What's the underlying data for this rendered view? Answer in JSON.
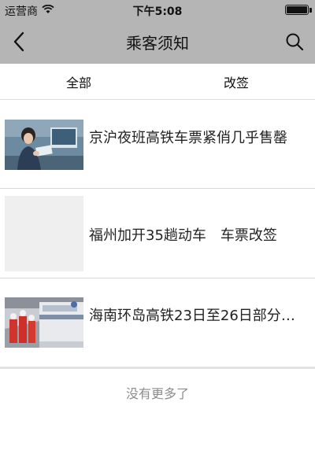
{
  "status": {
    "carrier": "运营商",
    "time": "下午5:08",
    "battery_level": 1.0
  },
  "header": {
    "title": "乘客须知",
    "back_icon": "chevron-left-icon",
    "search_icon": "search-icon"
  },
  "tabs": [
    {
      "label": "全部"
    },
    {
      "label": "改签"
    }
  ],
  "articles": [
    {
      "title": "京沪夜班高铁车票紧俏几乎售罄",
      "thumbnail": "ticket-counter-photo"
    },
    {
      "title": "福州加开35趟动车　车票改签",
      "thumbnail": "placeholder"
    },
    {
      "title": "海南环岛高铁23日至26日部分停运",
      "thumbnail": "train-station-photo"
    }
  ],
  "footer": {
    "no_more_text": "没有更多了"
  }
}
